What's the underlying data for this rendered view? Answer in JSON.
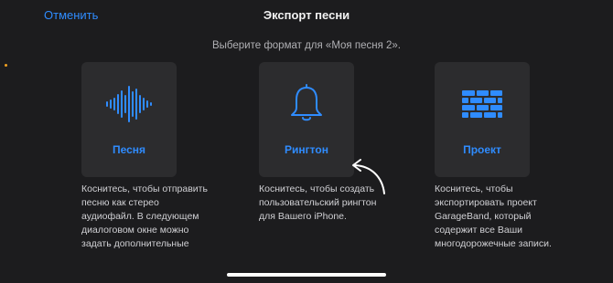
{
  "header": {
    "cancel_label": "Отменить",
    "title": "Экспорт песни"
  },
  "subtitle": "Выберите формат для «Моя песня 2».",
  "options": [
    {
      "label": "Песня",
      "icon": "waveform-icon",
      "description": "Коснитесь, чтобы отправить песню как стерео аудиофайл. В следующем диалоговом окне можно задать дополнительные"
    },
    {
      "label": "Рингтон",
      "icon": "bell-icon",
      "description": "Коснитесь, чтобы создать пользовательский рингтон для Вашего iPhone."
    },
    {
      "label": "Проект",
      "icon": "bricks-icon",
      "description": "Коснитесь, чтобы экспортировать проект GarageBand, который содержит все Ваши многодорожечные записи."
    }
  ],
  "colors": {
    "accent": "#2f8cff",
    "background": "#1c1c1e",
    "card": "#2c2c2e"
  }
}
